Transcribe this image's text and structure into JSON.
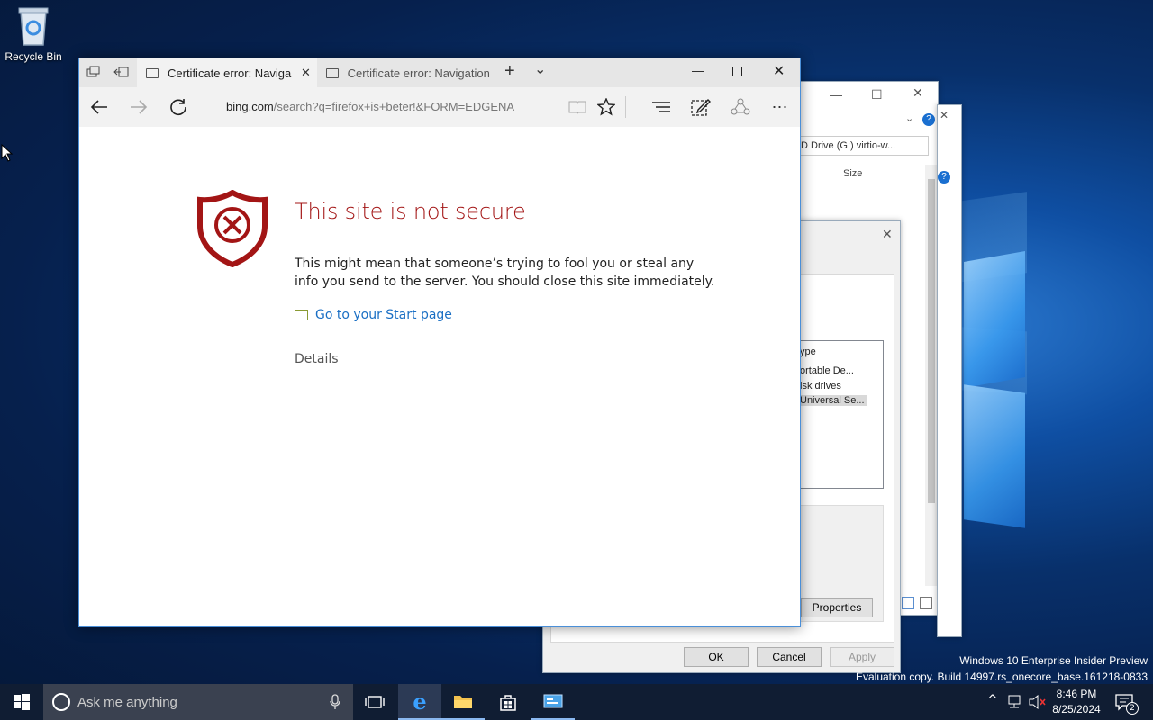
{
  "desktop": {
    "recycle_bin_label": "Recycle Bin",
    "watermark_line1": "Windows 10 Enterprise Insider Preview",
    "watermark_line2": "Evaluation copy. Build 14997.rs_onecore_base.161218-0833"
  },
  "edge": {
    "tabs": [
      {
        "label": "Certificate error: Naviga"
      },
      {
        "label": "Certificate error: Navigation"
      }
    ],
    "address": {
      "host": "bing.com",
      "path": "/search?q=firefox+is+beter!&FORM=EDGENA"
    },
    "page": {
      "title": "This site is not secure",
      "body": "This might mean that someone’s trying to fool you or steal any info you send to the server. You should close this site immediately.",
      "start_link": "Go to your Start page",
      "details": "Details"
    }
  },
  "explorer_back": {
    "search_text": "D Drive (G:) virtio-w...",
    "column_size": "Size"
  },
  "device_dialog": {
    "column_type": "ype",
    "rows": [
      "ortable De...",
      "isk drives",
      "Universal Se..."
    ],
    "properties_button": "Properties",
    "ok_button": "OK",
    "cancel_button": "Cancel",
    "apply_button": "Apply"
  },
  "taskbar": {
    "search_placeholder": "Ask me anything",
    "time": "8:46 PM",
    "date": "8/25/2024",
    "notification_count": "2"
  },
  "colors": {
    "error_red": "#a31515",
    "link_blue": "#1a6fc4",
    "taskbar": "#101d33"
  }
}
